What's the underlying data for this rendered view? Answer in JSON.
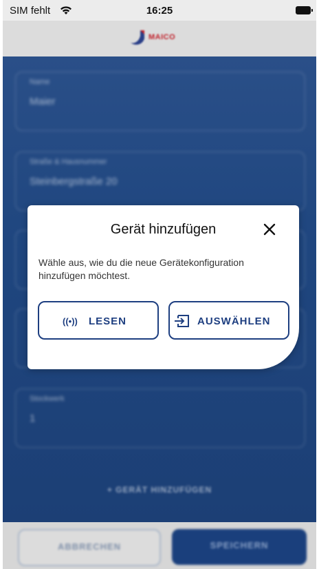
{
  "status_bar": {
    "carrier": "SIM fehlt",
    "time": "16:25",
    "wifi_icon": "wifi-icon",
    "battery_icon": "battery-icon"
  },
  "header": {
    "logo_text": "MAICO"
  },
  "background_form": {
    "fields": [
      {
        "label": "Name",
        "value": "Maier"
      },
      {
        "label": "Straße & Hausnummer",
        "value": "Steinbergstraße 20"
      },
      {
        "label": "Stockwerk",
        "value": "1"
      }
    ],
    "add_device_label": "+ GERÄT HINZUFÜGEN"
  },
  "footer": {
    "cancel_label": "ABBRECHEN",
    "save_label": "SPEICHERN"
  },
  "dialog": {
    "title": "Gerät hinzufügen",
    "description": "Wähle aus, wie du die neue Gerätekonfiguration hinzufügen möchtest.",
    "read_icon": "((•))",
    "read_label": "LESEN",
    "select_label": "AUSWÄHLEN",
    "colors": {
      "accent": "#1d3e80",
      "overlay": "#1f467f"
    }
  }
}
